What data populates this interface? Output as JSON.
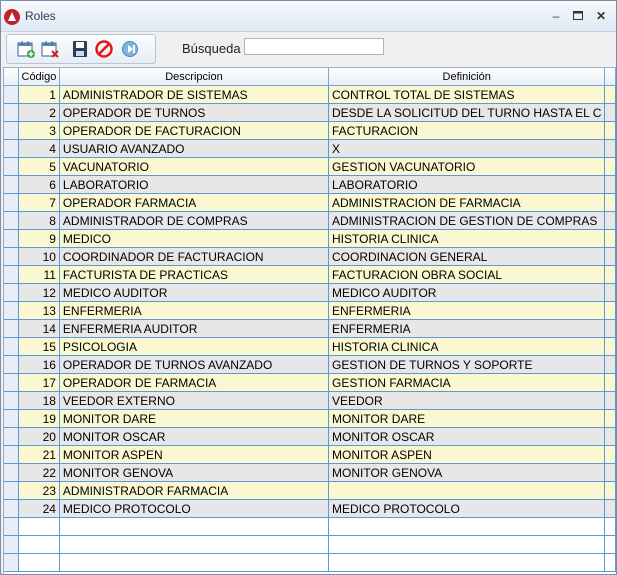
{
  "window": {
    "title": "Roles"
  },
  "toolbar": {
    "search_label": "Búsqueda",
    "search_value": ""
  },
  "columns": {
    "code": "Código",
    "desc": "Descripcion",
    "def": "Definición"
  },
  "rows": [
    {
      "code": "1",
      "desc": "ADMINISTRADOR DE SISTEMAS",
      "def": "CONTROL TOTAL DE SISTEMAS"
    },
    {
      "code": "2",
      "desc": "OPERADOR DE TURNOS",
      "def": "DESDE LA SOLICITUD DEL TURNO HASTA EL C"
    },
    {
      "code": "3",
      "desc": "OPERADOR DE FACTURACION",
      "def": "FACTURACION"
    },
    {
      "code": "4",
      "desc": "USUARIO AVANZADO",
      "def": "X"
    },
    {
      "code": "5",
      "desc": "VACUNATORIO",
      "def": "GESTION VACUNATORIO"
    },
    {
      "code": "6",
      "desc": "LABORATORIO",
      "def": "LABORATORIO"
    },
    {
      "code": "7",
      "desc": "OPERADOR FARMACIA",
      "def": "ADMINISTRACION DE FARMACIA"
    },
    {
      "code": "8",
      "desc": "ADMINISTRADOR DE COMPRAS",
      "def": "ADMINISTRACION DE GESTION DE COMPRAS"
    },
    {
      "code": "9",
      "desc": "MEDICO",
      "def": "HISTORIA CLINICA"
    },
    {
      "code": "10",
      "desc": "COORDINADOR DE FACTURACION",
      "def": "COORDINACION GENERAL"
    },
    {
      "code": "11",
      "desc": "FACTURISTA DE PRACTICAS",
      "def": "FACTURACION OBRA SOCIAL"
    },
    {
      "code": "12",
      "desc": "MEDICO AUDITOR",
      "def": "MEDICO AUDITOR"
    },
    {
      "code": "13",
      "desc": "ENFERMERIA",
      "def": "ENFERMERIA"
    },
    {
      "code": "14",
      "desc": "ENFERMERIA AUDITOR",
      "def": "ENFERMERIA"
    },
    {
      "code": "15",
      "desc": "PSICOLOGIA",
      "def": "HISTORIA CLINICA"
    },
    {
      "code": "16",
      "desc": "OPERADOR DE TURNOS AVANZADO",
      "def": "GESTION DE TURNOS Y SOPORTE"
    },
    {
      "code": "17",
      "desc": "OPERADOR DE FARMACIA",
      "def": "GESTION FARMACIA"
    },
    {
      "code": "18",
      "desc": "VEEDOR EXTERNO",
      "def": "VEEDOR"
    },
    {
      "code": "19",
      "desc": "MONITOR DARE",
      "def": "MONITOR DARE"
    },
    {
      "code": "20",
      "desc": "MONITOR OSCAR",
      "def": "MONITOR OSCAR"
    },
    {
      "code": "21",
      "desc": "MONITOR ASPEN",
      "def": "MONITOR ASPEN"
    },
    {
      "code": "22",
      "desc": "MONITOR GENOVA",
      "def": "MONITOR GENOVA"
    },
    {
      "code": "23",
      "desc": "ADMINISTRADOR FARMACIA",
      "def": ""
    },
    {
      "code": "24",
      "desc": "MEDICO PROTOCOLO",
      "def": "MEDICO PROTOCOLO"
    }
  ],
  "colors": {
    "row_odd": "#fbf7d0",
    "row_even": "#e7e7e7",
    "grid_line": "#5a9bd5"
  },
  "icons": [
    "app-logo-icon",
    "new-record-icon",
    "delete-record-icon",
    "save-icon",
    "cancel-icon",
    "next-icon",
    "minimize-icon",
    "maximize-icon",
    "close-icon"
  ]
}
